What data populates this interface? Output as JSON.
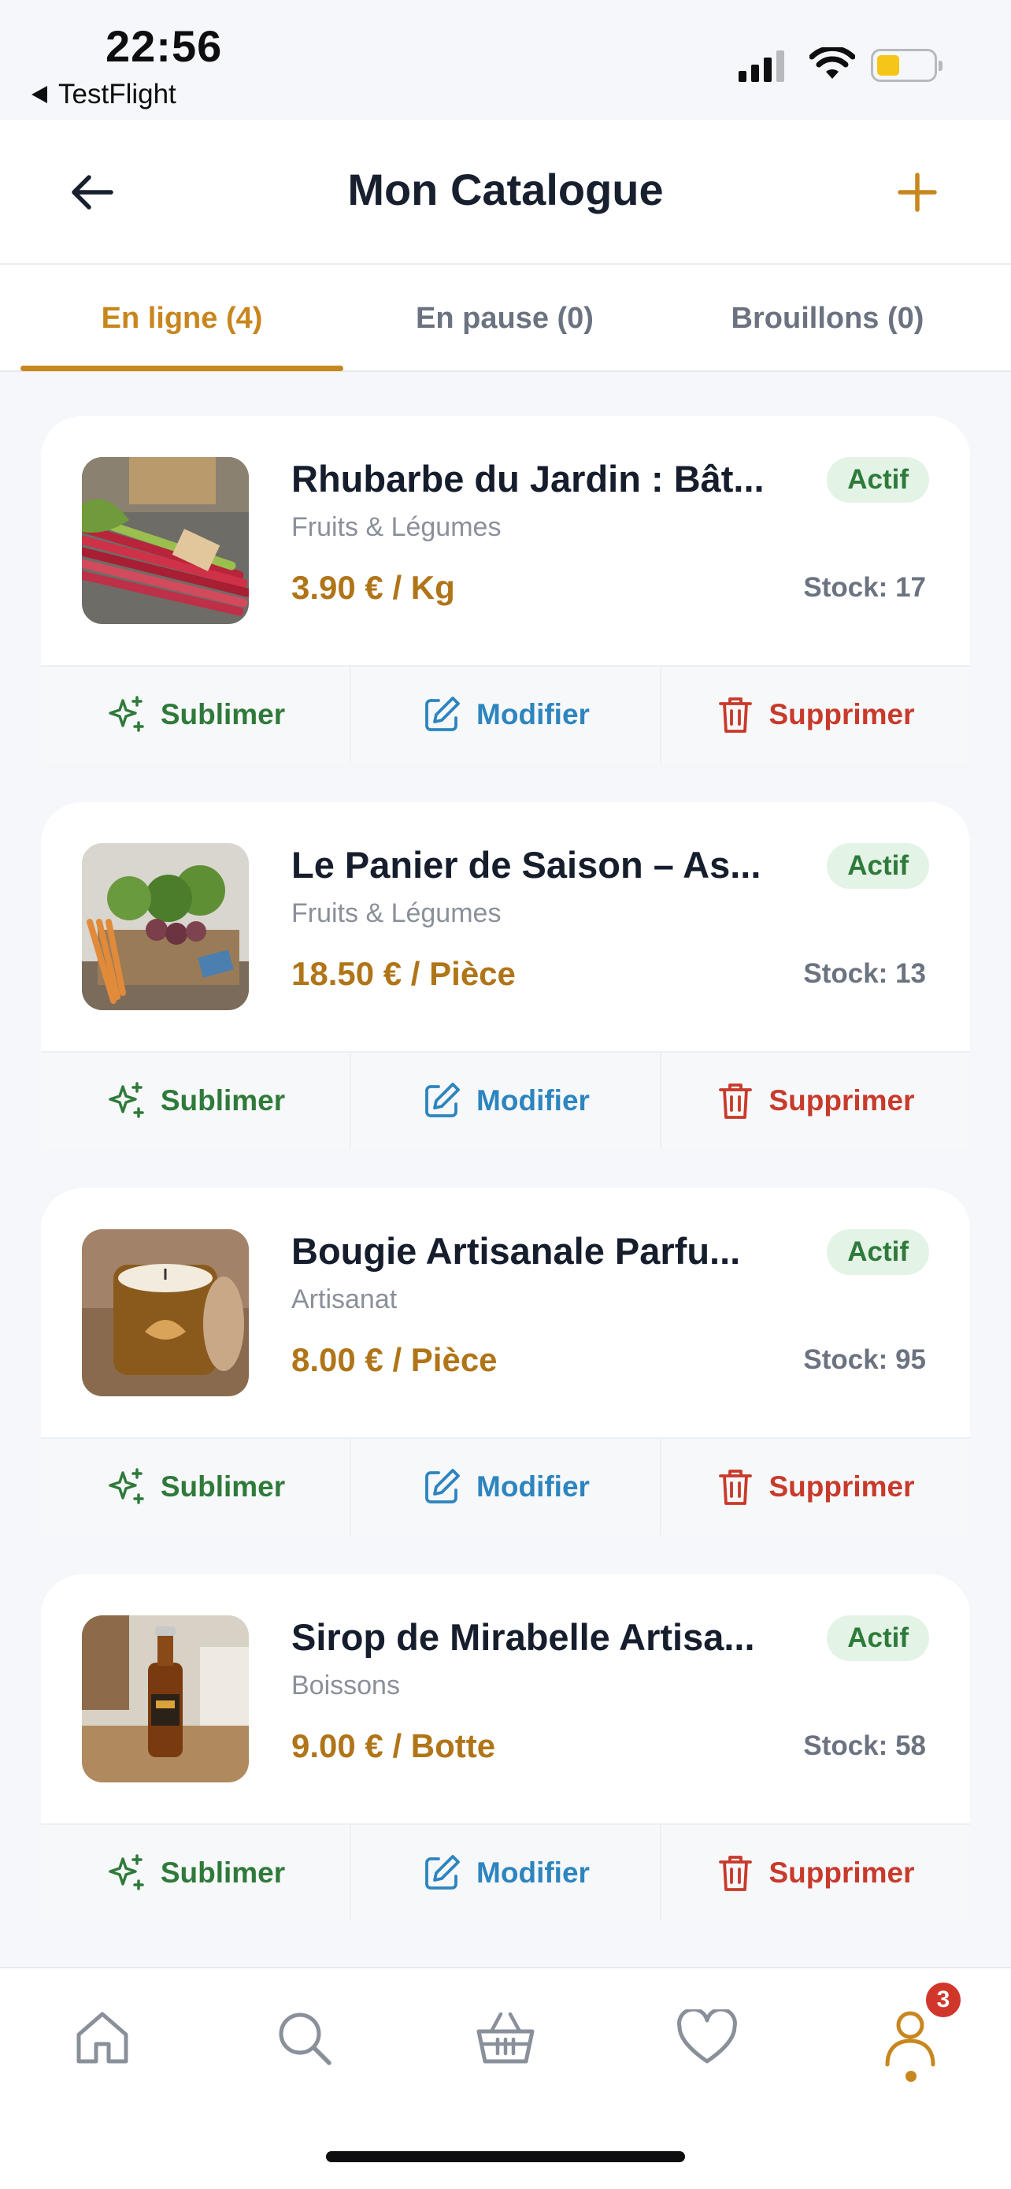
{
  "status_bar": {
    "time": "22:56",
    "back_app": "TestFlight",
    "battery_color": "#f5c518"
  },
  "header": {
    "title": "Mon Catalogue",
    "back_icon": "arrow-left-icon",
    "add_icon": "plus-icon"
  },
  "tabs": [
    {
      "label": "En ligne (4)",
      "active": true
    },
    {
      "label": "En pause (0)",
      "active": false
    },
    {
      "label": "Brouillons (0)",
      "active": false
    }
  ],
  "products": [
    {
      "name": "Rhubarbe du Jardin : Bât...",
      "category": "Fruits & Légumes",
      "price": "3.90 € / Kg",
      "stock": "Stock: 17",
      "status": "Actif"
    },
    {
      "name": "Le Panier de Saison – As...",
      "category": "Fruits & Légumes",
      "price": "18.50 € / Pièce",
      "stock": "Stock: 13",
      "status": "Actif"
    },
    {
      "name": "Bougie Artisanale Parfu...",
      "category": "Artisanat",
      "price": "8.00 € / Pièce",
      "stock": "Stock: 95",
      "status": "Actif"
    },
    {
      "name": "Sirop de Mirabelle Artisa...",
      "category": "Boissons",
      "price": "9.00 € / Botte",
      "stock": "Stock: 58",
      "status": "Actif"
    }
  ],
  "actions": {
    "sublimer": "Sublimer",
    "modifier": "Modifier",
    "supprimer": "Supprimer"
  },
  "bottom_nav": {
    "items": [
      "home-icon",
      "search-icon",
      "basket-icon",
      "heart-icon",
      "profile-icon"
    ],
    "profile_badge": "3"
  },
  "colors": {
    "accent": "#c8861e",
    "price": "#b07518",
    "active_badge_bg": "#e3f3e6",
    "sublimer": "#2f7a3a",
    "modifier": "#2d85bf",
    "supprimer": "#c83a2b"
  }
}
